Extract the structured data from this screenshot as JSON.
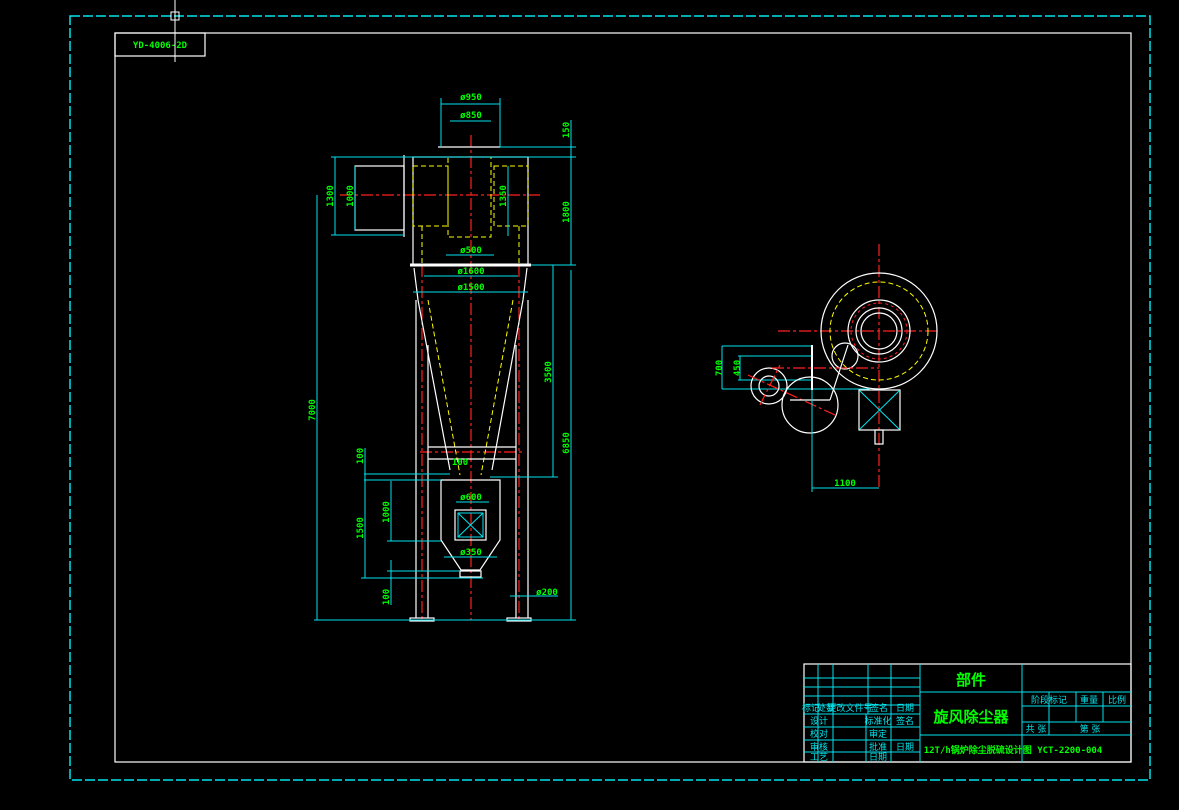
{
  "drawing": {
    "corner_label": "YD-4006-2D",
    "front_view_dims": {
      "d950": "ø950",
      "d850": "ø850",
      "h150": "150",
      "h1300": "1300",
      "h1000": "1000",
      "h1350": "1350",
      "h1800": "1800",
      "d500": "ø500",
      "d1600": "ø1600",
      "d1500": "ø1500",
      "h3500": "3500",
      "h7000": "7000",
      "h6850": "6850",
      "h100a": "100",
      "h100b": "100",
      "h1000b": "1000",
      "h1500": "1500",
      "d600": "ø600",
      "d350": "ø350",
      "h100c": "100",
      "d200": "ø200"
    },
    "side_view_dims": {
      "h700": "700",
      "h450": "450",
      "w1100": "1100"
    }
  },
  "title_block": {
    "part": "部件",
    "name": "旋风除尘器",
    "drawing_no": "12T/h锅炉除尘脱硫设计图 YCT-2200-004",
    "headers": [
      "标记",
      "处数",
      "更改文件号",
      "签名",
      "日期"
    ],
    "roles": [
      "设计",
      "校对",
      "审核",
      "工艺"
    ],
    "roles2": [
      "标准化",
      "审定",
      "批准",
      "日期"
    ],
    "sign": [
      "签名",
      "日期"
    ],
    "right_headers": [
      "阶段标记",
      "重量",
      "比例"
    ],
    "sheets": [
      "共 张",
      "第 张"
    ]
  },
  "colors": {
    "background": "#000000",
    "outline": "#ffffff",
    "dimension": "#00e5ee",
    "text": "#00ff00",
    "centerline": "#ff2020",
    "hidden": "#ffff00"
  }
}
